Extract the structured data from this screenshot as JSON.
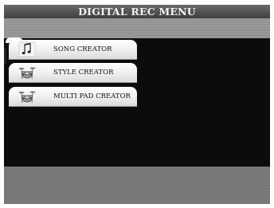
{
  "window": {
    "title": "DIGITAL REC MENU"
  },
  "menu": {
    "items": [
      {
        "label": "SONG CREATOR",
        "icon": "music-note-icon"
      },
      {
        "label": "STYLE CREATOR",
        "icon": "drum-kit-icon"
      },
      {
        "label": "MULTI PAD CREATOR",
        "icon": "drum-kit-icon"
      }
    ]
  }
}
